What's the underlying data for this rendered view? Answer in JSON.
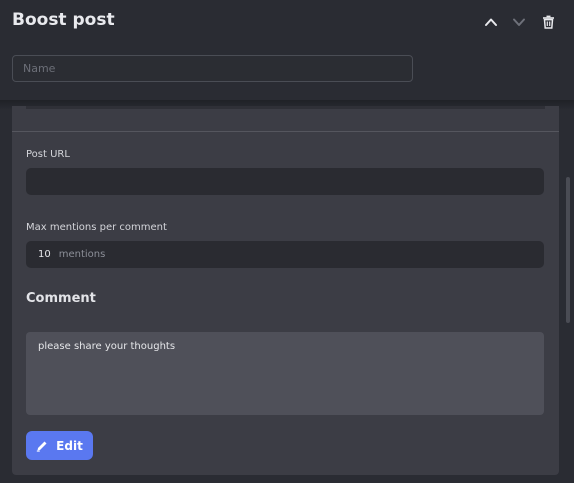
{
  "header": {
    "title": "Boost post",
    "move_up_icon": "chevron-up-icon",
    "move_down_icon": "chevron-down-icon",
    "delete_icon": "trash-icon"
  },
  "name_field": {
    "placeholder": "Name",
    "value": ""
  },
  "form": {
    "post_url": {
      "label": "Post URL",
      "value": ""
    },
    "max_mentions": {
      "label": "Max mentions per comment",
      "value": "10",
      "unit": "mentions"
    },
    "comment": {
      "section_title": "Comment",
      "text": "please share your thoughts"
    },
    "edit_button": {
      "label": "Edit",
      "icon": "pencil-icon"
    }
  },
  "colors": {
    "background": "#2a2c33",
    "panel": "#3c3d45",
    "accent": "#5a78f0"
  }
}
